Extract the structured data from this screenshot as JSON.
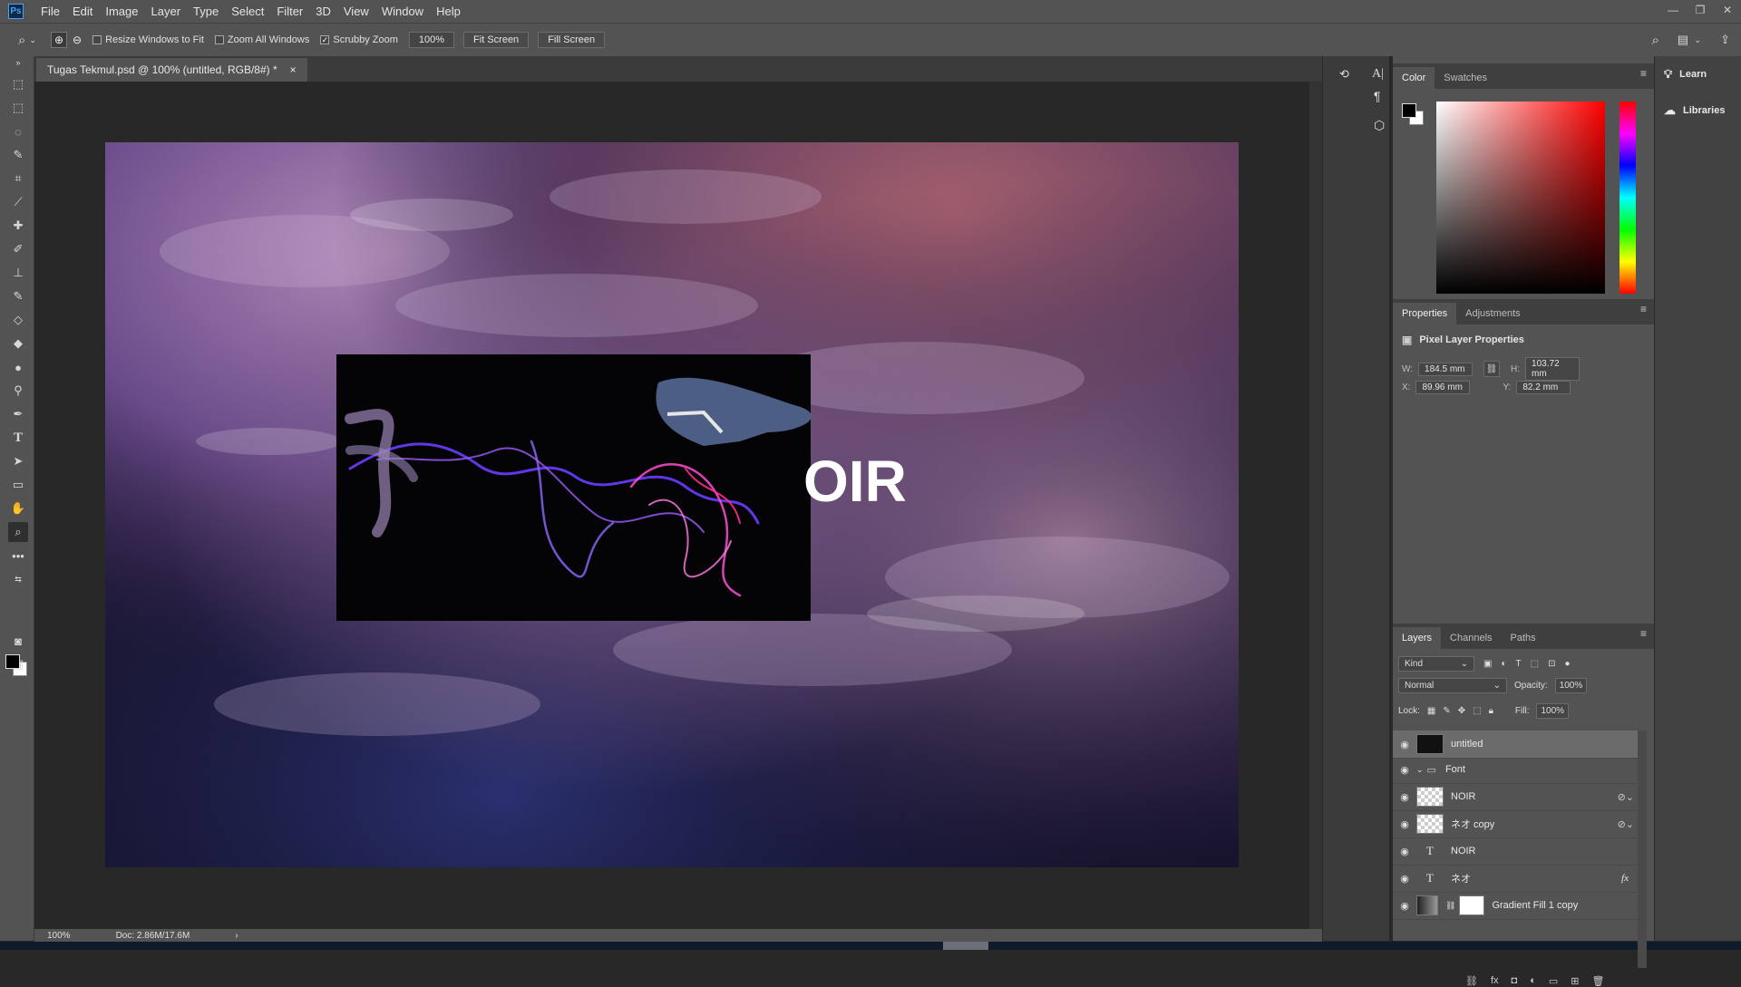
{
  "menubar": {
    "logo": "Ps",
    "items": [
      "File",
      "Edit",
      "Image",
      "Layer",
      "Type",
      "Select",
      "Filter",
      "3D",
      "View",
      "Window",
      "Help"
    ]
  },
  "options": {
    "resize_windows": "Resize Windows to Fit",
    "zoom_all": "Zoom All Windows",
    "scrubby": "Scrubby Zoom",
    "zoom_value": "100%",
    "fit_screen": "Fit Screen",
    "fill_screen": "Fill Screen"
  },
  "document": {
    "tab_title": "Tugas Tekmul.psd @ 100% (untitled, RGB/8#) *",
    "close": "×",
    "overlay_text": "OIR"
  },
  "status": {
    "zoom": "100%",
    "doc": "Doc: 2.86M/17.6M",
    "arrow": "›"
  },
  "color_panel": {
    "tabs": [
      "Color",
      "Swatches"
    ]
  },
  "properties_panel": {
    "tabs": [
      "Properties",
      "Adjustments"
    ],
    "heading": "Pixel Layer Properties",
    "w_label": "W:",
    "w_value": "184.5 mm",
    "h_label": "H:",
    "h_value": "103.72 mm",
    "x_label": "X:",
    "x_value": "89.96 mm",
    "y_label": "Y:",
    "y_value": "82.2 mm"
  },
  "layers_panel": {
    "tabs": [
      "Layers",
      "Channels",
      "Paths"
    ],
    "kind": "Kind",
    "blend_mode": "Normal",
    "opacity_label": "Opacity:",
    "opacity_value": "100%",
    "lock_label": "Lock:",
    "fill_label": "Fill:",
    "fill_value": "100%",
    "layers": [
      {
        "name": "untitled"
      },
      {
        "name": "Font"
      },
      {
        "name": "NOIR"
      },
      {
        "name": "ネオ copy"
      },
      {
        "name": "NOIR"
      },
      {
        "name": "ネオ"
      },
      {
        "name": "Gradient Fill 1 copy"
      }
    ],
    "fx": "fx"
  },
  "learn_panel": {
    "learn": "Learn",
    "libraries": "Libraries"
  }
}
